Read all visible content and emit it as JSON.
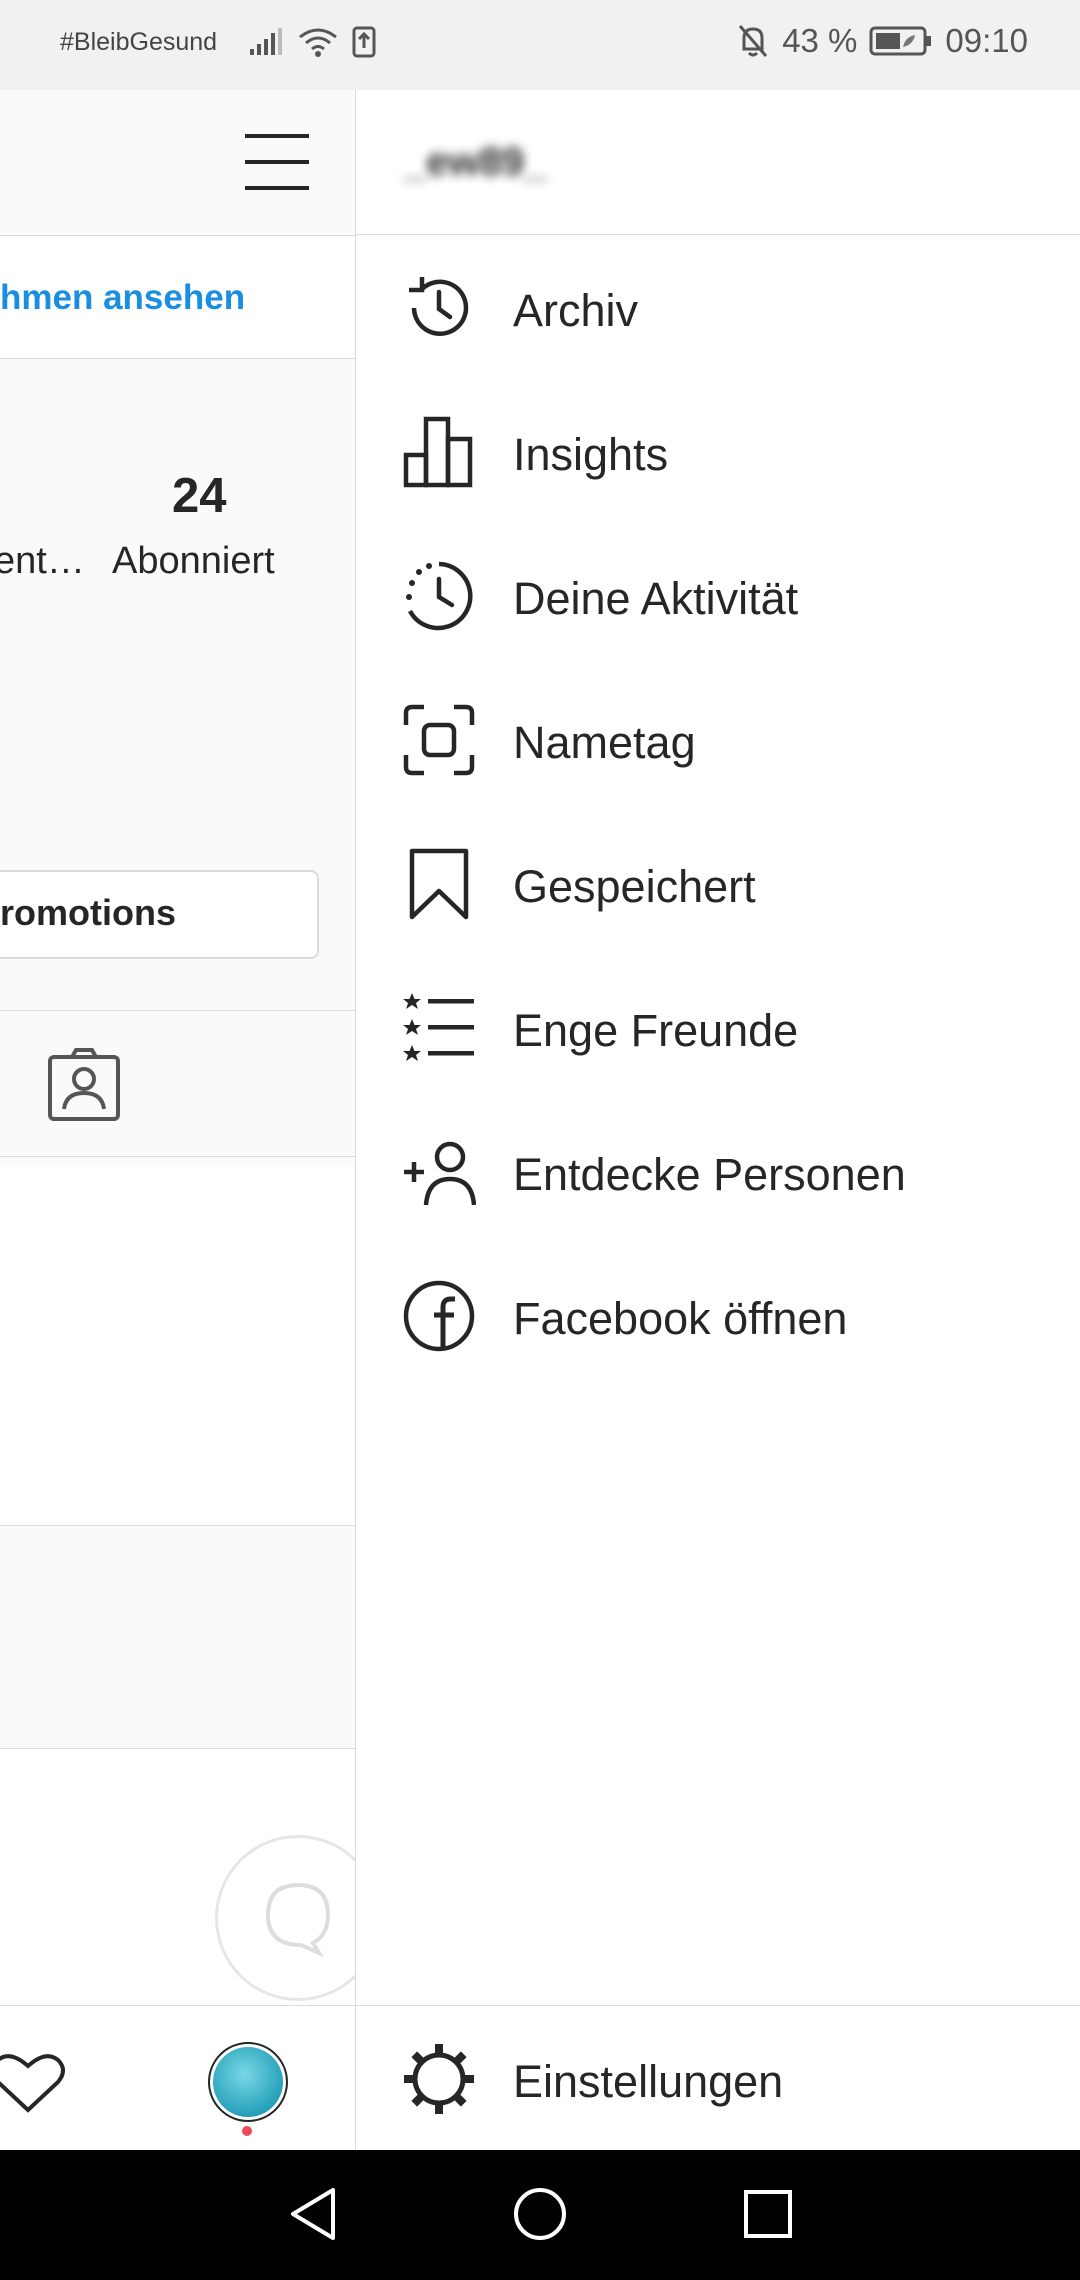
{
  "status_bar": {
    "carrier": "#BleibGesund",
    "battery": "43 %",
    "time": "09:10",
    "icons": [
      "signal-icon",
      "wifi-icon",
      "data-transfer-icon",
      "mute-icon",
      "battery-icon"
    ]
  },
  "profile": {
    "link_text": "hmen ansehen",
    "stat_partial_label": "ent…",
    "following_count": "24",
    "following_label": "Abonniert",
    "promotions_label": "romotions"
  },
  "drawer": {
    "username": "_ew89_",
    "items": [
      {
        "label": "Archiv",
        "icon": "archive-history-icon"
      },
      {
        "label": "Insights",
        "icon": "bar-chart-icon"
      },
      {
        "label": "Deine Aktivität",
        "icon": "activity-clock-icon"
      },
      {
        "label": "Nametag",
        "icon": "nametag-icon"
      },
      {
        "label": "Gespeichert",
        "icon": "bookmark-icon"
      },
      {
        "label": "Enge Freunde",
        "icon": "close-friends-icon"
      },
      {
        "label": "Entdecke Personen",
        "icon": "add-person-icon"
      },
      {
        "label": "Facebook öffnen",
        "icon": "facebook-icon"
      }
    ],
    "settings_label": "Einstellungen"
  },
  "colors": {
    "link_blue": "#1a8ee0",
    "text": "#262626",
    "divider": "#dbdbdb",
    "notification_dot": "#ed4956"
  }
}
